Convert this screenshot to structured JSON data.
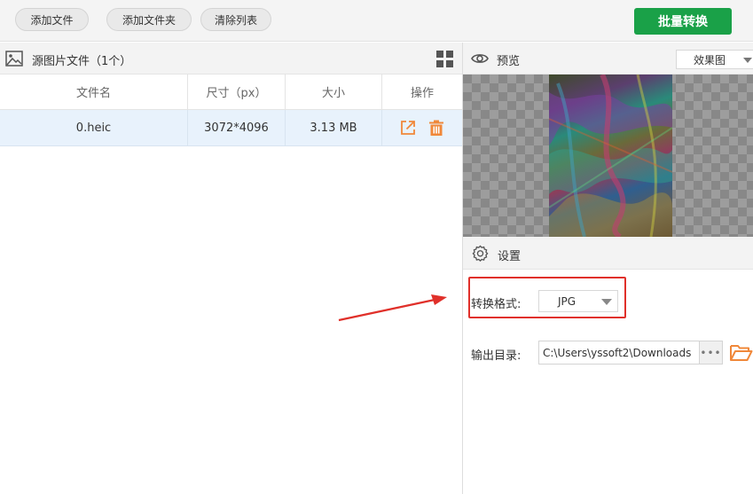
{
  "toolbar": {
    "add_file_label": "添加文件",
    "add_folder_label": "添加文件夹",
    "clear_list_label": "清除列表",
    "batch_convert_label": "批量转换"
  },
  "source_panel": {
    "title": "源图片文件（1个）",
    "columns": {
      "filename": "文件名",
      "size_px": "尺寸（px）",
      "file_size": "大小",
      "actions": "操作"
    },
    "rows": [
      {
        "filename": "0.heic",
        "size_px": "3072*4096",
        "file_size": "3.13 MB"
      }
    ]
  },
  "preview_panel": {
    "title": "预览",
    "view_mode_selected": "效果图"
  },
  "settings_panel": {
    "title": "设置",
    "format_label": "转换格式:",
    "format_value": "JPG",
    "output_label": "输出目录:",
    "output_path": "C:\\Users\\yssoft2\\Downloads",
    "browse_label": "•••"
  },
  "colors": {
    "accent_green": "#1aa148",
    "highlight_red": "#e0302a",
    "action_orange": "#f0883a",
    "row_selected": "#e8f2fc"
  }
}
